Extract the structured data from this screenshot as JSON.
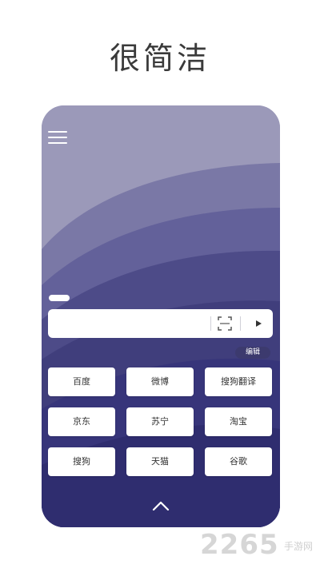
{
  "headline": "很简洁",
  "search": {
    "value": "",
    "placeholder": ""
  },
  "edit_label": "编辑",
  "shortcuts": [
    "百度",
    "微博",
    "搜狗翻译",
    "京东",
    "苏宁",
    "淘宝",
    "搜狗",
    "天猫",
    "谷歌"
  ],
  "watermark": {
    "number": "2265",
    "suffix": "手游网"
  },
  "colors": {
    "wave_light": "#9b99b9",
    "wave_mid": "#706e9c",
    "wave_dark": "#4a487e",
    "wave_deep": "#3a3872",
    "wave_deepest": "#302e66",
    "edit_bg": "#3c3a6e"
  },
  "icons": {
    "menu": "hamburger-icon",
    "scan": "scan-icon",
    "go": "play-arrow-icon",
    "collapse": "chevron-up-icon"
  }
}
